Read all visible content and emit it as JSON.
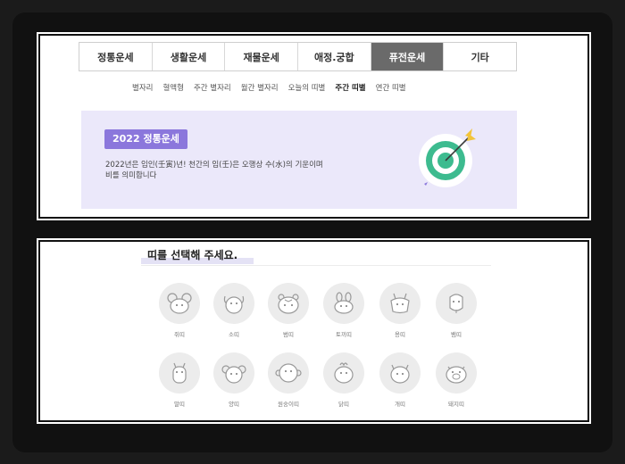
{
  "tabs": [
    {
      "label": "정통운세",
      "active": false
    },
    {
      "label": "생활운세",
      "active": false
    },
    {
      "label": "재물운세",
      "active": false
    },
    {
      "label": "애정.궁합",
      "active": false
    },
    {
      "label": "퓨전운세",
      "active": true
    },
    {
      "label": "기타",
      "active": false
    }
  ],
  "subnav": [
    {
      "label": "별자리",
      "active": false
    },
    {
      "label": "혈액형",
      "active": false
    },
    {
      "label": "주간 별자리",
      "active": false
    },
    {
      "label": "월간 별자리",
      "active": false
    },
    {
      "label": "오늘의 띠별",
      "active": false
    },
    {
      "label": "주간 띠별",
      "active": true
    },
    {
      "label": "연간 띠별",
      "active": false
    }
  ],
  "banner": {
    "badge": "2022 정통운세",
    "line1": "2022년은 임인(壬寅)년! 천간의 임(壬)은 오행상 수(水)의 기운이며",
    "line2": "비를 의미합니다"
  },
  "select_title": "띠를 선택해 주세요.",
  "zodiac": [
    {
      "label": "쥐띠",
      "icon": "rat-icon"
    },
    {
      "label": "소띠",
      "icon": "ox-icon"
    },
    {
      "label": "범띠",
      "icon": "tiger-icon"
    },
    {
      "label": "토끼띠",
      "icon": "rabbit-icon"
    },
    {
      "label": "용띠",
      "icon": "dragon-icon"
    },
    {
      "label": "뱀띠",
      "icon": "snake-icon"
    },
    {
      "label": "말띠",
      "icon": "horse-icon"
    },
    {
      "label": "양띠",
      "icon": "sheep-icon"
    },
    {
      "label": "원숭이띠",
      "icon": "monkey-icon"
    },
    {
      "label": "닭띠",
      "icon": "rooster-icon"
    },
    {
      "label": "개띠",
      "icon": "dog-icon"
    },
    {
      "label": "돼지띠",
      "icon": "pig-icon"
    }
  ],
  "colors": {
    "accent": "#8b77dc",
    "banner_bg": "#ebe8fa",
    "active_tab": "#6a6a6a",
    "target_green": "#3dbb8f",
    "arrow_yellow": "#f2c43a"
  }
}
